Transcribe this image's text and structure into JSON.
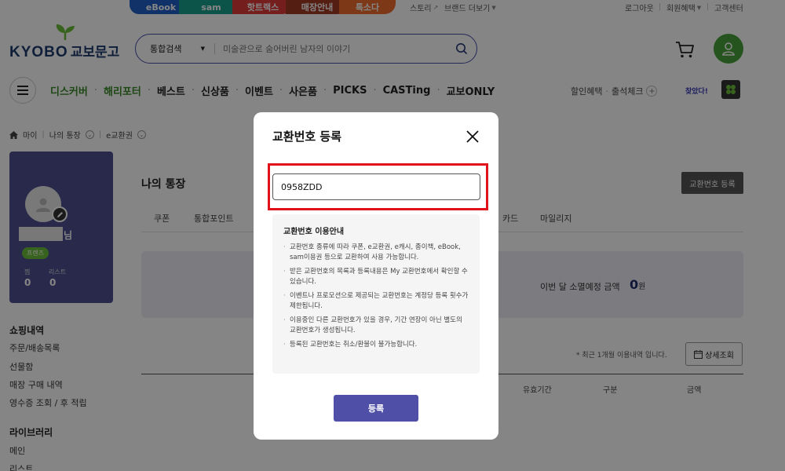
{
  "topbar": {
    "tabs": [
      "eBook",
      "sam",
      "핫트랙스",
      "매장안내",
      "톡소다"
    ],
    "links": [
      "스토리",
      "브랜드 더보기"
    ],
    "account_links": [
      "로그아웃",
      "회원혜택",
      "고객센터"
    ]
  },
  "header": {
    "logo_en": "KYOBO",
    "logo_ko": "교보문고",
    "search_category": "통합검색",
    "search_placeholder": "미술관으로 숨어버린 남자의 이야기"
  },
  "nav": {
    "items": [
      "디스커버",
      "해리포터",
      "베스트",
      "신상품",
      "이벤트",
      "사은품",
      "PICKS",
      "CASTing",
      "교보ONLY"
    ],
    "right_links": [
      "할인혜택",
      "출석체크"
    ],
    "found_label": "찾았다!"
  },
  "breadcrumb": [
    "마이",
    "나의 통장",
    "e교환권"
  ],
  "profile": {
    "name_suffix": "님",
    "grade": "프렌즈",
    "stats": [
      {
        "label": "찜",
        "value": "0"
      },
      {
        "label": "리스트",
        "value": "0"
      }
    ]
  },
  "sidebar": {
    "shopping_title": "쇼핑내역",
    "shopping_items": [
      "주문/배송목록",
      "선물함",
      "매장 구매 내역",
      "영수증 조회 / 후 적립"
    ],
    "library_title": "라이브러리",
    "library_items": [
      "메인",
      "리스트"
    ]
  },
  "main": {
    "title": "나의 통장",
    "register_button": "교환번호 등록",
    "tabs": [
      "쿠폰",
      "통합포인트",
      "카드",
      "마일리지"
    ],
    "expiring_label": "이번 달 소멸예정 금액",
    "expiring_value": "0",
    "expiring_unit": "원",
    "note": "최근 1개월 이용내역 입니다.",
    "detail_button": "상세조회",
    "table_headers": [
      "유효기간",
      "구분",
      "금액"
    ]
  },
  "modal": {
    "title": "교환번호 등록",
    "code_value": "0958ZDD",
    "info_title": "교환번호 이용안내",
    "info_items": [
      "교환번호 종류에 따라 쿠폰, e교환권, e캐시, 종이책, eBook, sam이용권 등으로 교환하여 사용 가능합니다.",
      "받은 교환번호의 목록과 등록내용은 My 교환번호에서 확인할 수 있습니다.",
      "이벤트나 프로모션으로 제공되는 교환번호는 계정당 등록 횟수가 제한됩니다.",
      "이용중인 다른 교환번호가 있을 경우, 기간 연장이 아닌 별도의 교환번호가 생성됩니다.",
      "등록된 교환번호는 취소/환불이 불가능합니다."
    ],
    "submit_label": "등록"
  },
  "colors": {
    "brand_purple": "#4f4fa8",
    "brand_green": "#4aa23a",
    "highlight_red": "#e0131a"
  }
}
